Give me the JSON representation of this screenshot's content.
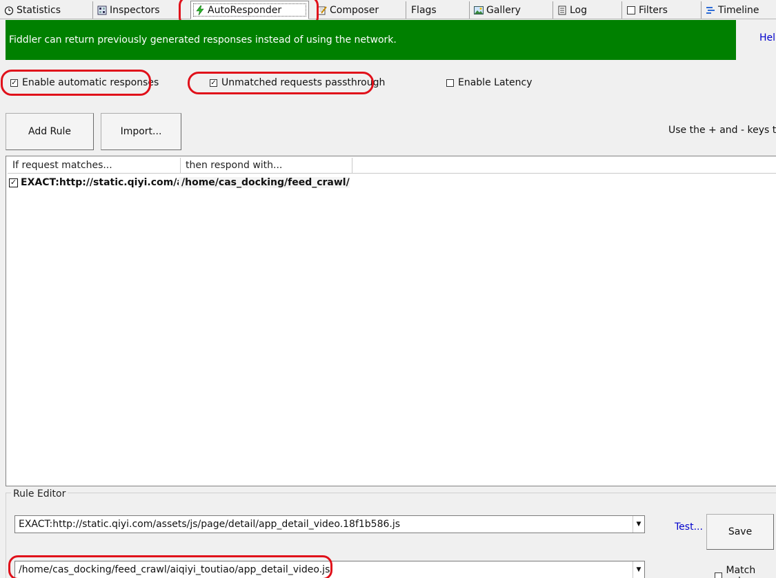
{
  "tabs": [
    {
      "label": "Statistics",
      "icon": "stopwatch-icon"
    },
    {
      "label": "Inspectors",
      "icon": "inspectors-grid-icon"
    },
    {
      "label": "AutoResponder",
      "icon": "lightning-icon"
    },
    {
      "label": "Composer",
      "icon": "pencil-note-icon"
    },
    {
      "label": "Flags",
      "icon": ""
    },
    {
      "label": "Gallery",
      "icon": "picture-icon"
    },
    {
      "label": "Log",
      "icon": "document-icon"
    },
    {
      "label": "Filters",
      "icon": "checkbox-icon"
    },
    {
      "label": "Timeline",
      "icon": "timeline-bars-icon"
    }
  ],
  "banner": {
    "text": "Fiddler can return previously generated responses instead of using the network.",
    "help_label": "Help"
  },
  "options": {
    "enable_auto": {
      "label": "Enable automatic responses",
      "checked": true
    },
    "unmatched": {
      "label": "Unmatched requests passthrough",
      "checked": true
    },
    "latency": {
      "label": "Enable Latency",
      "checked": false
    }
  },
  "toolbar": {
    "add_rule_label": "Add Rule",
    "import_label": "Import...",
    "hint": "Use the + and - keys to reo"
  },
  "rules_table": {
    "columns": [
      "If request matches...",
      "then respond with..."
    ],
    "rows": [
      {
        "checked": true,
        "match": "EXACT:http://static.qiyi.com/asset...",
        "respond": "/home/cas_docking/feed_crawl/aiq..."
      }
    ]
  },
  "rule_editor": {
    "title": "Rule Editor",
    "match_value": "EXACT:http://static.qiyi.com/assets/js/page/detail/app_detail_video.18f1b586.js",
    "respond_value": "/home/cas_docking/feed_crawl/aiqiyi_toutiao/app_detail_video.js",
    "test_label": "Test...",
    "save_label": "Save",
    "match_only_label": "Match only"
  },
  "colors": {
    "banner_green": "#008000",
    "highlight_red": "#e0101a",
    "link_blue": "#0000cc"
  }
}
